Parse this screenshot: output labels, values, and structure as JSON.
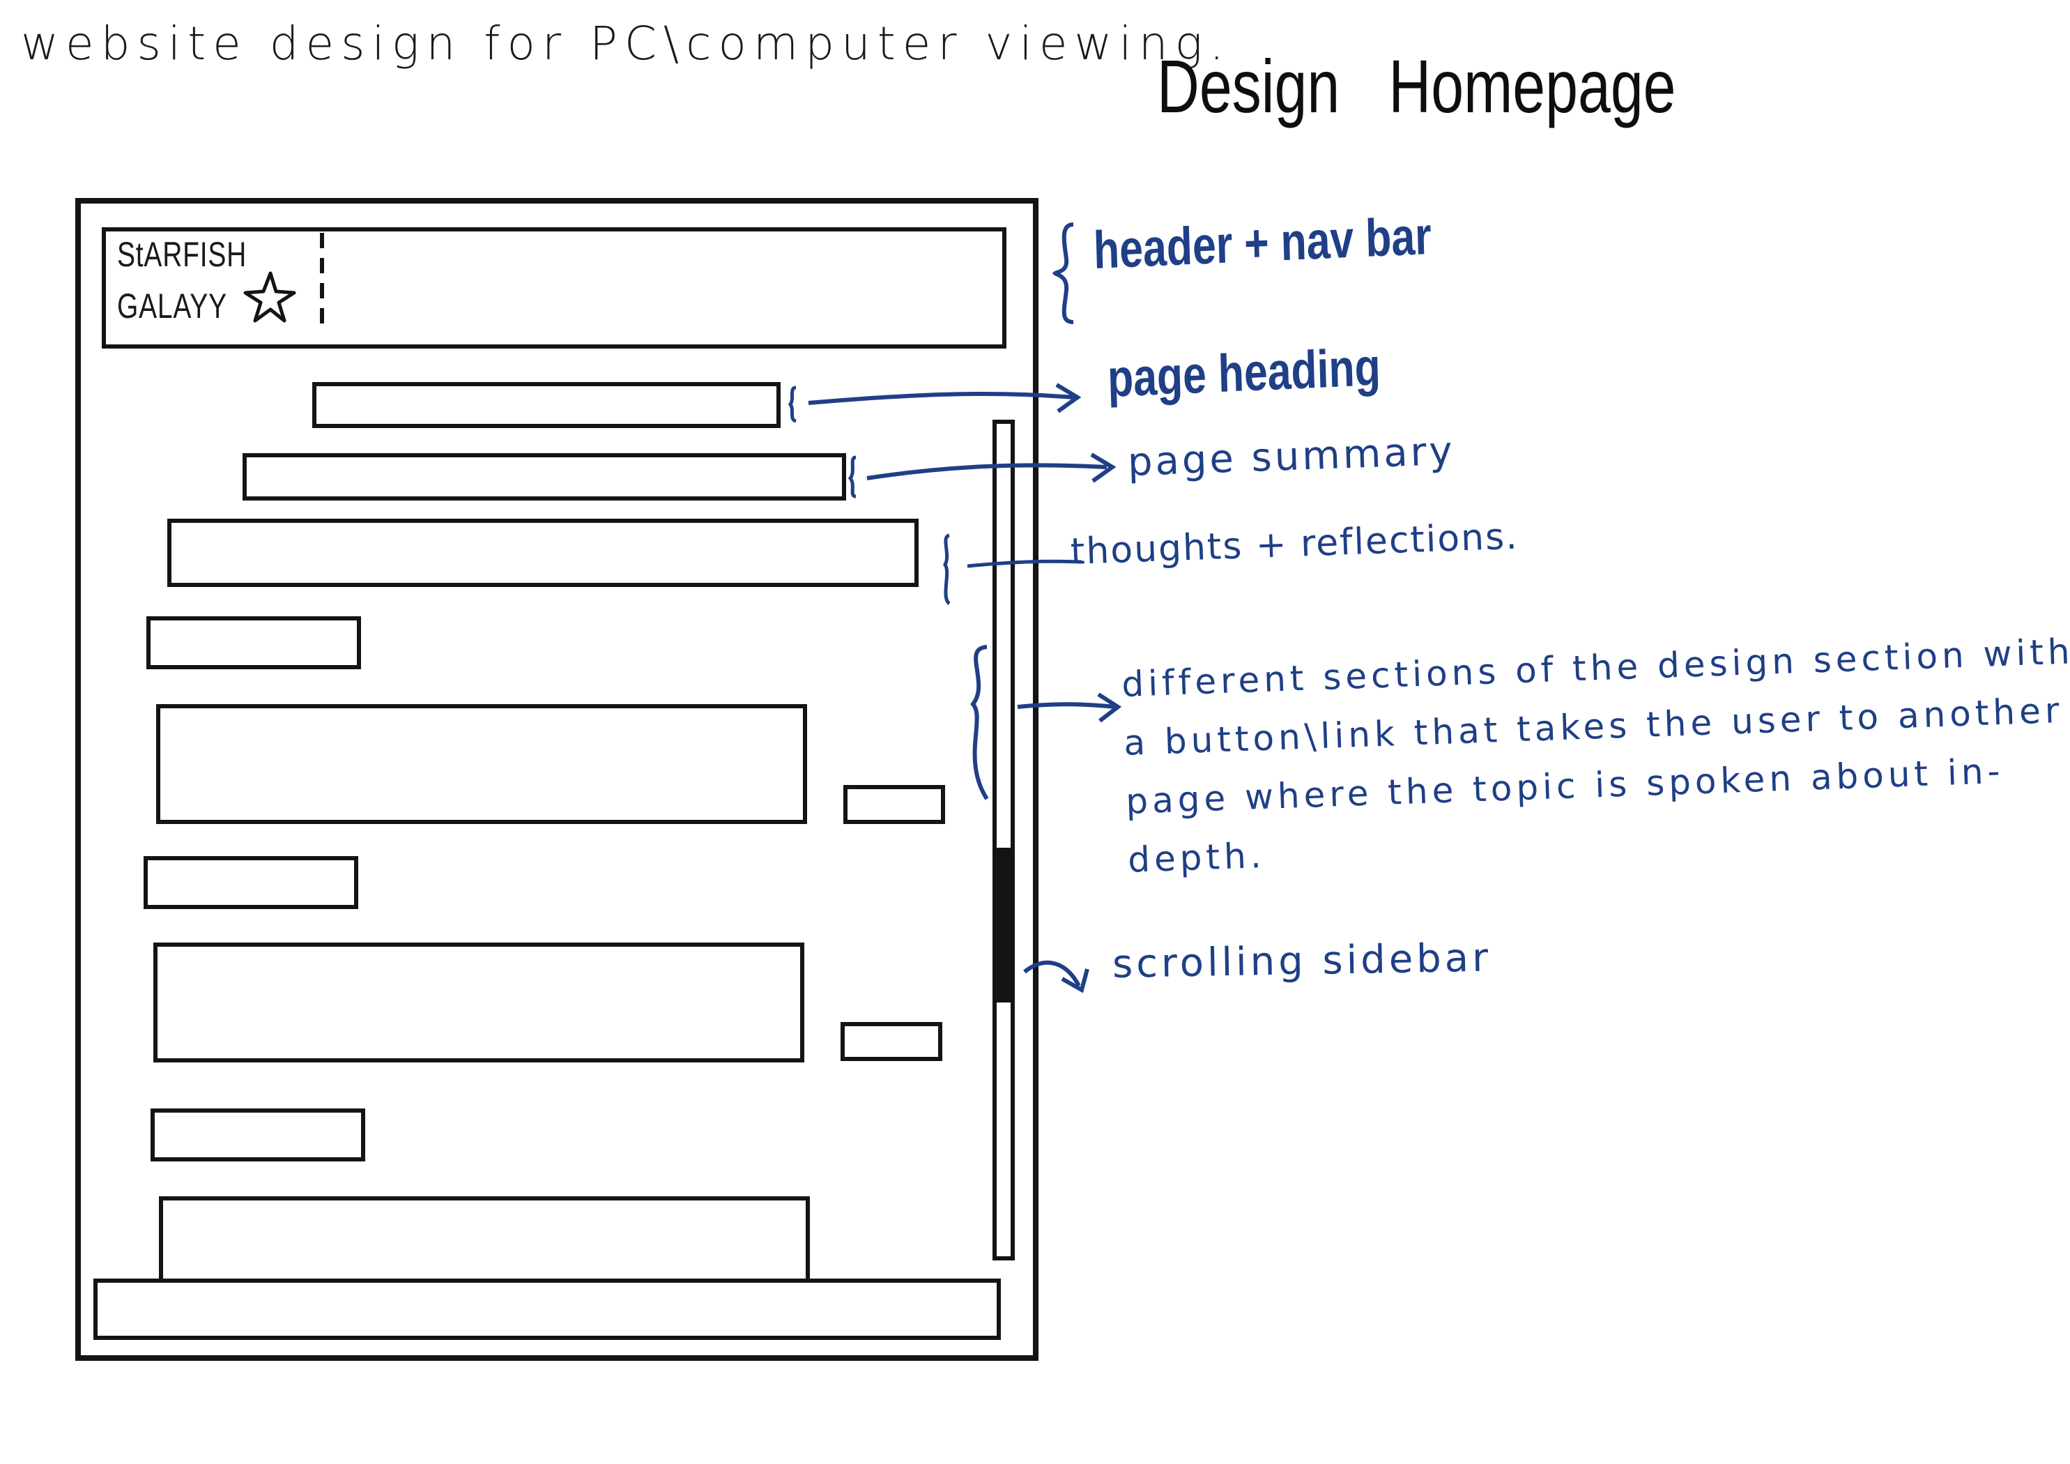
{
  "caption": "website design for PC\\computer viewing.",
  "title": "Design   Homepage",
  "logo": {
    "line1": "StARFISH",
    "line2": "GALAYY",
    "mark": "starfish-icon"
  },
  "annotations": {
    "header": "header + nav bar",
    "page_heading": "page heading",
    "page_summary": "page summary",
    "thoughts": "thoughts + reflections.",
    "sections": [
      "different sections of the design section with",
      "a button\\link that takes the user to another",
      "page where the topic is spoken about in-",
      "depth."
    ],
    "sidebar": "scrolling sidebar"
  },
  "colors": {
    "ink": "#141414",
    "annotation": "#1f3f86",
    "paper": "#ffffff"
  }
}
